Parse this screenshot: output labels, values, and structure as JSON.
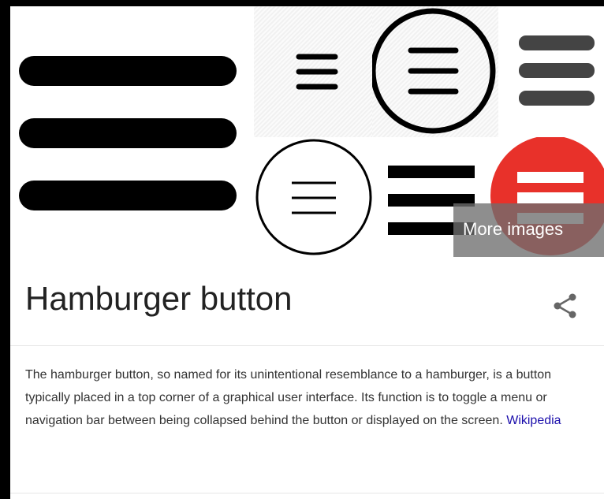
{
  "knowledge_panel": {
    "more_images_label": "More images",
    "title": "Hamburger button",
    "description": "The hamburger button, so named for its unintentional resemblance to a hamburger, is a button typically placed in a top corner of a graphical user interface. Its function is to toggle a menu or navigation bar between being collapsed behind the button or displayed on the screen.",
    "source_link_label": "Wikipedia"
  },
  "icons": {
    "share": "share-icon",
    "thumbnails": "hamburger-menu-icon"
  },
  "colors": {
    "link": "#1a0dab",
    "title": "#222222",
    "body_text": "#333333",
    "red_thumbnail": "#e8312a",
    "overlay": "#6e6e6e"
  }
}
